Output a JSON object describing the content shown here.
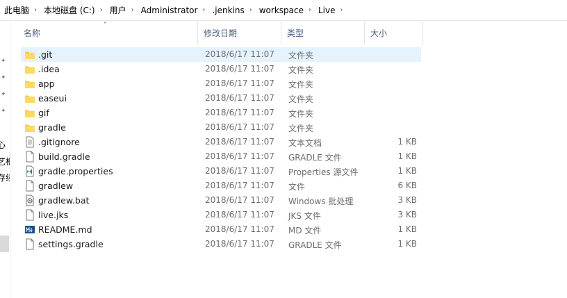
{
  "breadcrumb": [
    "此电脑",
    "本地磁盘 (C:)",
    "用户",
    "Administrator",
    ".jenkins",
    "workspace",
    "Live"
  ],
  "breadcrumb_separator": "›",
  "left_pane": {
    "labels": [
      "心",
      "艺框",
      "存续"
    ]
  },
  "columns": {
    "name": "名称",
    "modified": "修改日期",
    "type": "类型",
    "size": "大小"
  },
  "colors": {
    "selected_row": "#e5f3ff",
    "folder": "#f4c94e",
    "header_text": "#4c607a"
  },
  "files": [
    {
      "name": ".git",
      "date": "2018/6/17 11:07",
      "type": "文件夹",
      "size": "",
      "icon": "folder-icon",
      "selected": true
    },
    {
      "name": ".idea",
      "date": "2018/6/17 11:07",
      "type": "文件夹",
      "size": "",
      "icon": "folder-icon"
    },
    {
      "name": "app",
      "date": "2018/6/17 11:07",
      "type": "文件夹",
      "size": "",
      "icon": "folder-icon"
    },
    {
      "name": "easeui",
      "date": "2018/6/17 11:07",
      "type": "文件夹",
      "size": "",
      "icon": "folder-icon"
    },
    {
      "name": "gif",
      "date": "2018/6/17 11:07",
      "type": "文件夹",
      "size": "",
      "icon": "folder-icon"
    },
    {
      "name": "gradle",
      "date": "2018/6/17 11:07",
      "type": "文件夹",
      "size": "",
      "icon": "folder-icon"
    },
    {
      "name": ".gitignore",
      "date": "2018/6/17 11:07",
      "type": "文本文档",
      "size": "1 KB",
      "icon": "text-file-icon"
    },
    {
      "name": "build.gradle",
      "date": "2018/6/17 11:07",
      "type": "GRADLE 文件",
      "size": "1 KB",
      "icon": "file-icon"
    },
    {
      "name": "gradle.properties",
      "date": "2018/6/17 11:07",
      "type": "Properties 源文件",
      "size": "1 KB",
      "icon": "vs-file-icon"
    },
    {
      "name": "gradlew",
      "date": "2018/6/17 11:07",
      "type": "文件",
      "size": "6 KB",
      "icon": "file-icon"
    },
    {
      "name": "gradlew.bat",
      "date": "2018/6/17 11:07",
      "type": "Windows 批处理",
      "size": "3 KB",
      "icon": "batch-file-icon"
    },
    {
      "name": "live.jks",
      "date": "2018/6/17 11:07",
      "type": "JKS 文件",
      "size": "3 KB",
      "icon": "file-icon"
    },
    {
      "name": "README.md",
      "date": "2018/6/17 11:07",
      "type": "MD 文件",
      "size": "1 KB",
      "icon": "markdown-file-icon"
    },
    {
      "name": "settings.gradle",
      "date": "2018/6/17 11:07",
      "type": "GRADLE 文件",
      "size": "1 KB",
      "icon": "file-icon"
    }
  ]
}
